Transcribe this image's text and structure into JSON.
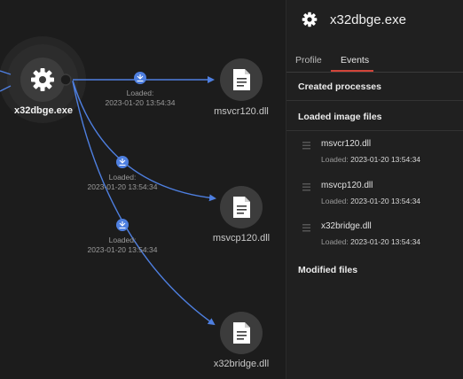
{
  "graph": {
    "main_node": {
      "label": "x32dbge.exe",
      "icon": "gear-icon"
    },
    "edges": [
      {
        "status": "Loaded:",
        "time": "2023-01-20 13:54:34",
        "target": "msvcr120.dll"
      },
      {
        "status": "Loaded:",
        "time": "2023-01-20 13:54:34",
        "target": "msvcp120.dll"
      },
      {
        "status": "Loaded:",
        "time": "2023-01-20 13:54:34",
        "target": "x32bridge.dll"
      }
    ],
    "accent_color": "#4e7fe0",
    "node_color": "#3c3c3c"
  },
  "panel": {
    "title": "x32dbge.exe",
    "icon": "gear-icon",
    "tabs": [
      {
        "label": "Profile"
      },
      {
        "label": "Events"
      }
    ],
    "active_tab": "Events",
    "sections": {
      "created": "Created processes",
      "loaded": "Loaded image files",
      "modified": "Modified files"
    },
    "loaded_items": [
      {
        "name": "msvcr120.dll",
        "meta_label": "Loaded:",
        "time": "2023-01-20 13:54:34"
      },
      {
        "name": "msvcp120.dll",
        "meta_label": "Loaded:",
        "time": "2023-01-20 13:54:34"
      },
      {
        "name": "x32bridge.dll",
        "meta_label": "Loaded:",
        "time": "2023-01-20 13:54:34"
      }
    ],
    "tab_underline_color": "#d2453a"
  }
}
